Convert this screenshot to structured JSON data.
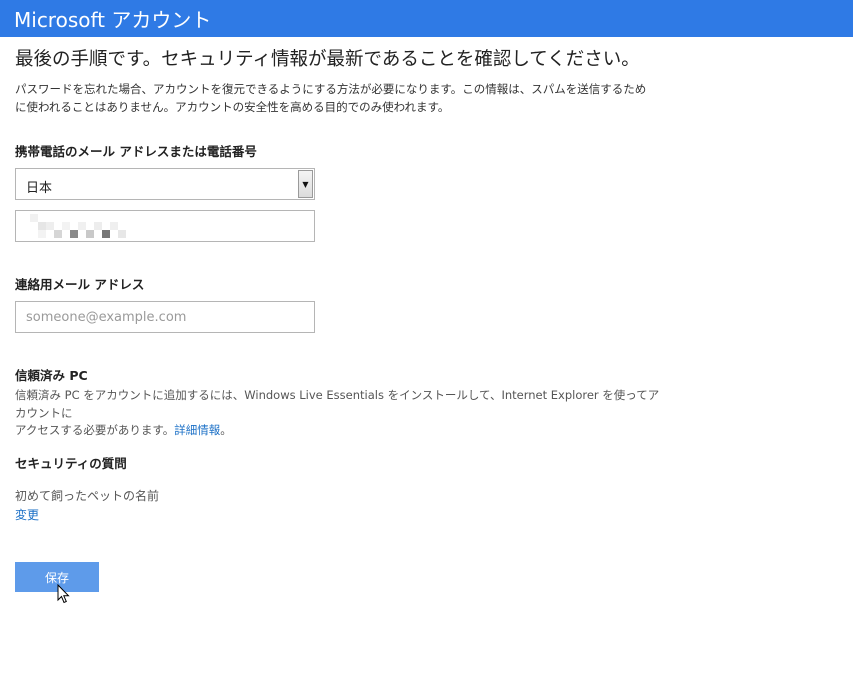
{
  "header": {
    "title": "Microsoft アカウント"
  },
  "main": {
    "title": "最後の手順です。セキュリティ情報が最新であることを確認してください。",
    "intro_line1": "パスワードを忘れた場合、アカウントを復元できるようにする方法が必要になります。この情報は、スパムを送信するため",
    "intro_line2": "に使われることはありません。アカウントの安全性を高める目的でのみ使われます。"
  },
  "phone_section": {
    "label": "携帯電話のメール アドレスまたは電話番号",
    "country_selected": "日本"
  },
  "contact_email": {
    "label": "連絡用メール アドレス",
    "placeholder": "someone@example.com"
  },
  "trusted_pc": {
    "label": "信頼済み PC",
    "description_line1": "信頼済み PC をアカウントに追加するには、Windows Live Essentials をインストールして、Internet Explorer を使ってアカウントに",
    "description_line2_prefix": "アクセスする必要があります。",
    "details_link": "詳細情報",
    "description_line2_suffix": "。"
  },
  "security_question": {
    "label": "セキュリティの質問",
    "question": "初めて飼ったペットの名前",
    "change_link": "変更"
  },
  "save_button": "保存",
  "colors": {
    "header": "#2f7ae5",
    "button": "#5e9bea",
    "link": "#1a6fc6"
  }
}
